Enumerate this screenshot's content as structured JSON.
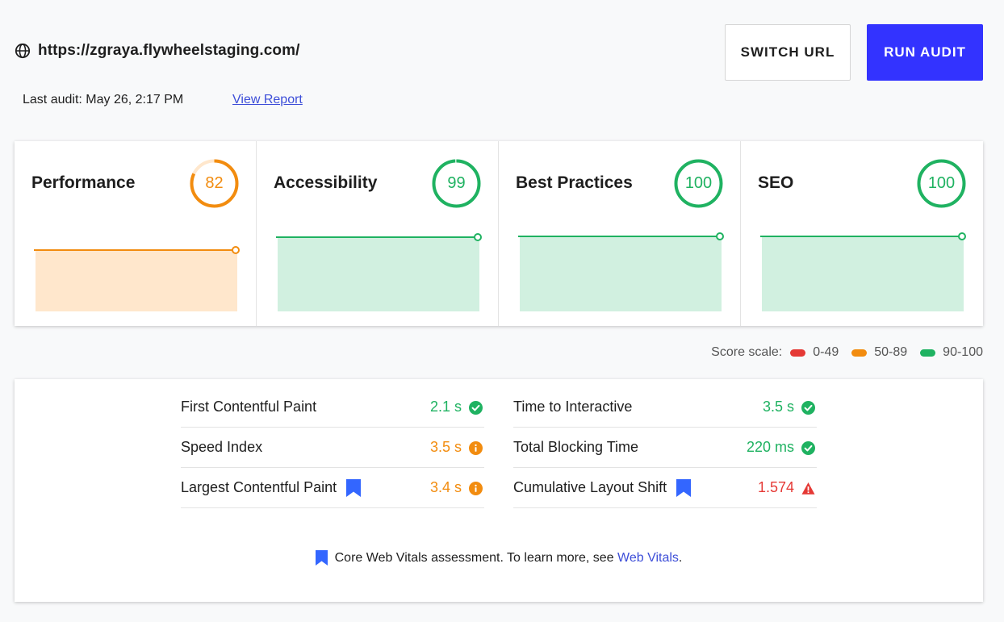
{
  "header": {
    "url": "https://zgraya.flywheelstaging.com/",
    "switch_label": "SWITCH URL",
    "run_label": "RUN AUDIT",
    "last_audit": "Last audit: May 26, 2:17 PM",
    "view_report": "View Report"
  },
  "colors": {
    "red": "#e53935",
    "orange": "#f28c0f",
    "green": "#1fb261",
    "orange_fill": "#ffe7cc",
    "green_fill": "#d1f0e0",
    "accent": "#3333ff",
    "bookmark": "#3366ff"
  },
  "cards": [
    {
      "title": "Performance",
      "score": "82",
      "value": 82,
      "status": "orange"
    },
    {
      "title": "Accessibility",
      "score": "99",
      "value": 99,
      "status": "green"
    },
    {
      "title": "Best Practices",
      "score": "100",
      "value": 100,
      "status": "green"
    },
    {
      "title": "SEO",
      "score": "100",
      "value": 100,
      "status": "green"
    }
  ],
  "scale": {
    "label": "Score scale:",
    "ranges": [
      {
        "label": "0-49",
        "status": "red"
      },
      {
        "label": "50-89",
        "status": "orange"
      },
      {
        "label": "90-100",
        "status": "green"
      }
    ]
  },
  "metrics": {
    "left": [
      {
        "name": "First Contentful Paint",
        "value": "2.1 s",
        "status": "green",
        "icon": "check-circle-icon",
        "web_vital": false
      },
      {
        "name": "Speed Index",
        "value": "3.5 s",
        "status": "orange",
        "icon": "info-circle-icon",
        "web_vital": false
      },
      {
        "name": "Largest Contentful Paint",
        "value": "3.4 s",
        "status": "orange",
        "icon": "info-circle-icon",
        "web_vital": true
      }
    ],
    "right": [
      {
        "name": "Time to Interactive",
        "value": "3.5 s",
        "status": "green",
        "icon": "check-circle-icon",
        "web_vital": false
      },
      {
        "name": "Total Blocking Time",
        "value": "220 ms",
        "status": "green",
        "icon": "check-circle-icon",
        "web_vital": false
      },
      {
        "name": "Cumulative Layout Shift",
        "value": "1.574",
        "status": "red",
        "icon": "warning-triangle-icon",
        "web_vital": true
      }
    ]
  },
  "footnote": {
    "text": "Core Web Vitals assessment. To learn more, see ",
    "link": "Web Vitals",
    "suffix": "."
  }
}
